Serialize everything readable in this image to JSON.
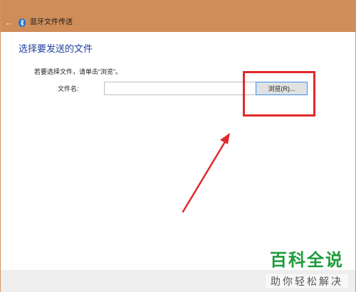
{
  "titlebar": {
    "back_icon": "arrow-left-icon",
    "bluetooth_icon": "bluetooth-icon",
    "title": "蓝牙文件传送"
  },
  "main": {
    "heading": "选择要发送的文件",
    "instruction": "若要选择文件，请单击“浏览”。",
    "filename_label": "文件名:",
    "filename_value": "",
    "browse_label": "浏览(R)..."
  },
  "annotation": {
    "highlight_color": "#e02a2a",
    "arrow_color": "#e02a2a"
  },
  "watermark": {
    "main": "百科全说",
    "sub": "助你轻松解决",
    "color": "#1e9b3c"
  },
  "colors": {
    "titlebar": "#cf8d59",
    "heading": "#1f3f9c"
  }
}
